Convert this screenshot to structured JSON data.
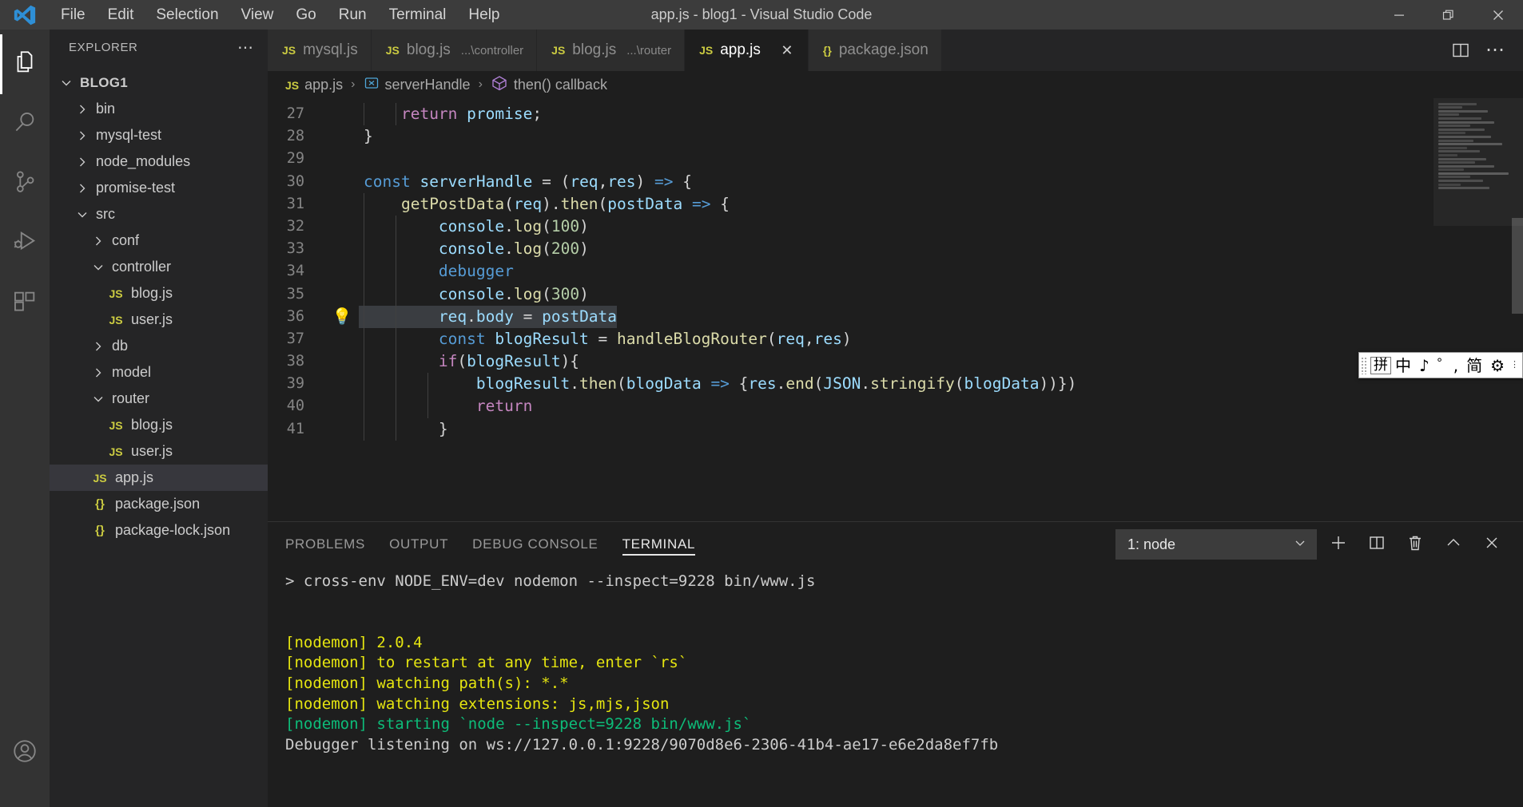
{
  "window": {
    "title": "app.js - blog1 - Visual Studio Code",
    "minimize_label": "—",
    "restore_label": "restore-icon",
    "close_label": "✕"
  },
  "menu": {
    "items": [
      "File",
      "Edit",
      "Selection",
      "View",
      "Go",
      "Run",
      "Terminal",
      "Help"
    ]
  },
  "activitybar": {
    "items": [
      {
        "name": "explorer",
        "icon": "files-icon",
        "active": true
      },
      {
        "name": "search",
        "icon": "search-icon",
        "active": false
      },
      {
        "name": "source-control",
        "icon": "source-control-icon",
        "active": false
      },
      {
        "name": "run-and-debug",
        "icon": "run-debug-icon",
        "active": false
      },
      {
        "name": "extensions",
        "icon": "extensions-icon",
        "active": false
      }
    ],
    "bottom": [
      {
        "name": "accounts",
        "icon": "account-icon"
      }
    ]
  },
  "sidebar": {
    "header": "EXPLORER",
    "more_actions": "⋯",
    "tree": [
      {
        "label": "BLOG1",
        "depth": 0,
        "kind": "root",
        "expanded": true,
        "selected": false
      },
      {
        "label": "bin",
        "depth": 1,
        "kind": "folder",
        "expanded": false,
        "selected": false
      },
      {
        "label": "mysql-test",
        "depth": 1,
        "kind": "folder",
        "expanded": false,
        "selected": false
      },
      {
        "label": "node_modules",
        "depth": 1,
        "kind": "folder",
        "expanded": false,
        "selected": false
      },
      {
        "label": "promise-test",
        "depth": 1,
        "kind": "folder",
        "expanded": false,
        "selected": false
      },
      {
        "label": "src",
        "depth": 1,
        "kind": "folder",
        "expanded": true,
        "selected": false
      },
      {
        "label": "conf",
        "depth": 2,
        "kind": "folder",
        "expanded": false,
        "selected": false
      },
      {
        "label": "controller",
        "depth": 2,
        "kind": "folder",
        "expanded": true,
        "selected": false
      },
      {
        "label": "blog.js",
        "depth": 3,
        "kind": "js",
        "expanded": null,
        "selected": false
      },
      {
        "label": "user.js",
        "depth": 3,
        "kind": "js",
        "expanded": null,
        "selected": false
      },
      {
        "label": "db",
        "depth": 2,
        "kind": "folder",
        "expanded": false,
        "selected": false
      },
      {
        "label": "model",
        "depth": 2,
        "kind": "folder",
        "expanded": false,
        "selected": false
      },
      {
        "label": "router",
        "depth": 2,
        "kind": "folder",
        "expanded": true,
        "selected": false
      },
      {
        "label": "blog.js",
        "depth": 3,
        "kind": "js",
        "expanded": null,
        "selected": false
      },
      {
        "label": "user.js",
        "depth": 3,
        "kind": "js",
        "expanded": null,
        "selected": false
      },
      {
        "label": "app.js",
        "depth": 2,
        "kind": "js",
        "expanded": null,
        "selected": true
      },
      {
        "label": "package.json",
        "depth": 2,
        "kind": "json",
        "expanded": null,
        "selected": false
      },
      {
        "label": "package-lock.json",
        "depth": 2,
        "kind": "json",
        "expanded": null,
        "selected": false
      }
    ]
  },
  "editor": {
    "overflow_label": "⋯",
    "tabs": [
      {
        "label": "mysql.js",
        "sub": "",
        "icon": "JS",
        "active": false,
        "closable": false
      },
      {
        "label": "blog.js",
        "sub": "...\\controller",
        "icon": "JS",
        "active": false,
        "closable": false
      },
      {
        "label": "blog.js",
        "sub": "...\\router",
        "icon": "JS",
        "active": false,
        "closable": false
      },
      {
        "label": "app.js",
        "sub": "",
        "icon": "JS",
        "active": true,
        "closable": true,
        "close_label": "✕"
      },
      {
        "label": "package.json",
        "sub": "",
        "icon": "{}",
        "active": false,
        "closable": false
      }
    ],
    "actions": [
      {
        "name": "split-editor-button",
        "icon": "split-editor-icon"
      },
      {
        "name": "more-actions-button",
        "icon": "ellipsis-icon",
        "label": "⋯"
      }
    ],
    "breadcrumb": [
      {
        "label": "app.js",
        "icon": "js-file-icon"
      },
      {
        "label": "serverHandle",
        "icon": "variable-icon"
      },
      {
        "label": "then() callback",
        "icon": "function-icon"
      }
    ],
    "breadcrumb_separator": "›",
    "lines": [
      {
        "num": 27,
        "indent": 2,
        "bulb": false,
        "tokens": [
          {
            "t": "    ",
            "c": "plain"
          },
          {
            "t": "return",
            "c": "key"
          },
          {
            "t": " ",
            "c": "plain"
          },
          {
            "t": "promise",
            "c": "var"
          },
          {
            "t": ";",
            "c": "plain"
          }
        ]
      },
      {
        "num": 28,
        "indent": 0,
        "bulb": false,
        "tokens": [
          {
            "t": "}",
            "c": "plain"
          }
        ]
      },
      {
        "num": 29,
        "indent": 0,
        "bulb": false,
        "tokens": []
      },
      {
        "num": 30,
        "indent": 0,
        "bulb": false,
        "tokens": [
          {
            "t": "const",
            "c": "decl"
          },
          {
            "t": " ",
            "c": "plain"
          },
          {
            "t": "serverHandle",
            "c": "var"
          },
          {
            "t": " = ",
            "c": "plain"
          },
          {
            "t": "(",
            "c": "plain"
          },
          {
            "t": "req",
            "c": "var"
          },
          {
            "t": ",",
            "c": "plain"
          },
          {
            "t": "res",
            "c": "var"
          },
          {
            "t": ")",
            "c": "plain"
          },
          {
            "t": " ",
            "c": "plain"
          },
          {
            "t": "=>",
            "c": "arrow"
          },
          {
            "t": " {",
            "c": "plain"
          }
        ]
      },
      {
        "num": 31,
        "indent": 1,
        "bulb": false,
        "tokens": [
          {
            "t": "    ",
            "c": "plain"
          },
          {
            "t": "getPostData",
            "c": "fn"
          },
          {
            "t": "(",
            "c": "plain"
          },
          {
            "t": "req",
            "c": "var"
          },
          {
            "t": ").",
            "c": "plain"
          },
          {
            "t": "then",
            "c": "fn"
          },
          {
            "t": "(",
            "c": "plain"
          },
          {
            "t": "postData",
            "c": "var"
          },
          {
            "t": " ",
            "c": "plain"
          },
          {
            "t": "=>",
            "c": "arrow"
          },
          {
            "t": " {",
            "c": "plain"
          }
        ]
      },
      {
        "num": 32,
        "indent": 2,
        "bulb": false,
        "tokens": [
          {
            "t": "        ",
            "c": "plain"
          },
          {
            "t": "console",
            "c": "var"
          },
          {
            "t": ".",
            "c": "plain"
          },
          {
            "t": "log",
            "c": "fn"
          },
          {
            "t": "(",
            "c": "plain"
          },
          {
            "t": "100",
            "c": "num"
          },
          {
            "t": ")",
            "c": "plain"
          }
        ]
      },
      {
        "num": 33,
        "indent": 2,
        "bulb": false,
        "tokens": [
          {
            "t": "        ",
            "c": "plain"
          },
          {
            "t": "console",
            "c": "var"
          },
          {
            "t": ".",
            "c": "plain"
          },
          {
            "t": "log",
            "c": "fn"
          },
          {
            "t": "(",
            "c": "plain"
          },
          {
            "t": "200",
            "c": "num"
          },
          {
            "t": ")",
            "c": "plain"
          }
        ]
      },
      {
        "num": 34,
        "indent": 2,
        "bulb": false,
        "tokens": [
          {
            "t": "        ",
            "c": "plain"
          },
          {
            "t": "debugger",
            "c": "decl"
          }
        ]
      },
      {
        "num": 35,
        "indent": 2,
        "bulb": false,
        "tokens": [
          {
            "t": "        ",
            "c": "plain"
          },
          {
            "t": "console",
            "c": "var"
          },
          {
            "t": ".",
            "c": "plain"
          },
          {
            "t": "log",
            "c": "fn"
          },
          {
            "t": "(",
            "c": "plain"
          },
          {
            "t": "300",
            "c": "num"
          },
          {
            "t": ")",
            "c": "plain"
          }
        ]
      },
      {
        "num": 36,
        "indent": 2,
        "bulb": true,
        "selected": true,
        "tokens": [
          {
            "t": "        ",
            "c": "plain"
          },
          {
            "t": "req",
            "c": "var"
          },
          {
            "t": ".",
            "c": "plain"
          },
          {
            "t": "body",
            "c": "var"
          },
          {
            "t": " = ",
            "c": "plain"
          },
          {
            "t": "postData",
            "c": "var"
          }
        ]
      },
      {
        "num": 37,
        "indent": 2,
        "bulb": false,
        "tokens": [
          {
            "t": "        ",
            "c": "plain"
          },
          {
            "t": "const",
            "c": "decl"
          },
          {
            "t": " ",
            "c": "plain"
          },
          {
            "t": "blogResult",
            "c": "var"
          },
          {
            "t": " = ",
            "c": "plain"
          },
          {
            "t": "handleBlogRouter",
            "c": "fn"
          },
          {
            "t": "(",
            "c": "plain"
          },
          {
            "t": "req",
            "c": "var"
          },
          {
            "t": ",",
            "c": "plain"
          },
          {
            "t": "res",
            "c": "var"
          },
          {
            "t": ")",
            "c": "plain"
          }
        ]
      },
      {
        "num": 38,
        "indent": 2,
        "bulb": false,
        "tokens": [
          {
            "t": "        ",
            "c": "plain"
          },
          {
            "t": "if",
            "c": "key"
          },
          {
            "t": "(",
            "c": "plain"
          },
          {
            "t": "blogResult",
            "c": "var"
          },
          {
            "t": "){",
            "c": "plain"
          }
        ]
      },
      {
        "num": 39,
        "indent": 3,
        "bulb": false,
        "tokens": [
          {
            "t": "            ",
            "c": "plain"
          },
          {
            "t": "blogResult",
            "c": "var"
          },
          {
            "t": ".",
            "c": "plain"
          },
          {
            "t": "then",
            "c": "fn"
          },
          {
            "t": "(",
            "c": "plain"
          },
          {
            "t": "blogData",
            "c": "var"
          },
          {
            "t": " ",
            "c": "plain"
          },
          {
            "t": "=>",
            "c": "arrow"
          },
          {
            "t": " {",
            "c": "plain"
          },
          {
            "t": "res",
            "c": "var"
          },
          {
            "t": ".",
            "c": "plain"
          },
          {
            "t": "end",
            "c": "fn"
          },
          {
            "t": "(",
            "c": "plain"
          },
          {
            "t": "JSON",
            "c": "var"
          },
          {
            "t": ".",
            "c": "plain"
          },
          {
            "t": "stringify",
            "c": "fn"
          },
          {
            "t": "(",
            "c": "plain"
          },
          {
            "t": "blogData",
            "c": "var"
          },
          {
            "t": "))})",
            "c": "plain"
          }
        ]
      },
      {
        "num": 40,
        "indent": 3,
        "bulb": false,
        "tokens": [
          {
            "t": "            ",
            "c": "plain"
          },
          {
            "t": "return",
            "c": "key"
          }
        ]
      },
      {
        "num": 41,
        "indent": 2,
        "bulb": false,
        "tokens": [
          {
            "t": "        ",
            "c": "plain"
          },
          {
            "t": "}",
            "c": "plain"
          }
        ]
      }
    ]
  },
  "ime": {
    "items": [
      "拼",
      "中",
      "♪",
      "゜,",
      "简",
      "⚙"
    ],
    "caret": "⋮"
  },
  "panel": {
    "tabs": [
      {
        "label": "PROBLEMS",
        "active": false
      },
      {
        "label": "OUTPUT",
        "active": false
      },
      {
        "label": "DEBUG CONSOLE",
        "active": false
      },
      {
        "label": "TERMINAL",
        "active": true
      }
    ],
    "terminal_select": {
      "value": "1: node",
      "chevron": "⌄"
    },
    "actions": [
      {
        "name": "new-terminal-button",
        "icon": "plus-icon"
      },
      {
        "name": "split-terminal-button",
        "icon": "split-icon"
      },
      {
        "name": "kill-terminal-button",
        "icon": "trash-icon"
      },
      {
        "name": "maximize-panel-button",
        "icon": "chevron-up-icon"
      },
      {
        "name": "close-panel-button",
        "icon": "close-icon"
      }
    ],
    "terminal_lines": [
      {
        "text": "> cross-env NODE_ENV=dev nodemon --inspect=9228 bin/www.js",
        "color": "white"
      },
      {
        "text": "",
        "color": "white"
      },
      {
        "text": "",
        "color": "white"
      },
      {
        "text": "[nodemon] 2.0.4",
        "color": "yellow"
      },
      {
        "text": "[nodemon] to restart at any time, enter `rs`",
        "color": "yellow"
      },
      {
        "text": "[nodemon] watching path(s): *.*",
        "color": "yellow"
      },
      {
        "text": "[nodemon] watching extensions: js,mjs,json",
        "color": "yellow"
      },
      {
        "text": "[nodemon] starting `node --inspect=9228 bin/www.js`",
        "color": "green"
      },
      {
        "text": "Debugger listening on ws://127.0.0.1:9228/9070d8e6-2306-41b4-ae17-e6e2da8ef7fb",
        "color": "white"
      }
    ]
  },
  "colors": {
    "accent": "#007acc",
    "titlebar_bg": "#3c3c3c",
    "sidebar_bg": "#252526",
    "editor_bg": "#1e1e1e",
    "activitybar_bg": "#333333",
    "selection": "#264f78",
    "terminal_yellow": "#e5e510",
    "terminal_green": "#0dbc79"
  }
}
